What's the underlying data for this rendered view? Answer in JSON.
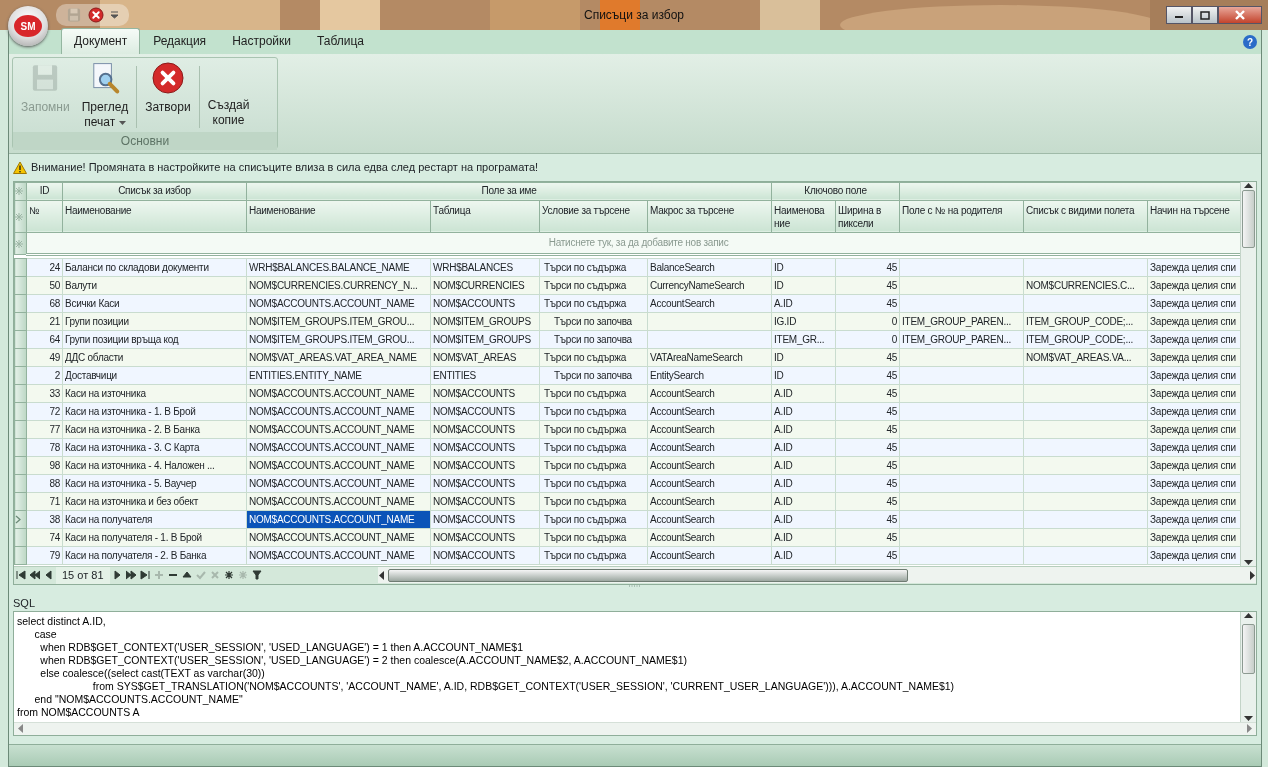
{
  "window": {
    "title": "Списъци за избор",
    "logo": "SM"
  },
  "quick_access": [
    {
      "kind": "save",
      "disabled": true
    },
    {
      "kind": "close",
      "disabled": false
    },
    {
      "kind": "dropdown",
      "disabled": false
    }
  ],
  "ribbon": {
    "tabs": [
      {
        "label": "Документ",
        "selected": true
      },
      {
        "label": "Редакция",
        "selected": false
      },
      {
        "label": "Настройки",
        "selected": false
      },
      {
        "label": "Таблица",
        "selected": false
      }
    ],
    "help": "?",
    "group": {
      "label": "Основни",
      "buttons": [
        {
          "kind": "save",
          "label": "Запомни",
          "disabled": true,
          "dropdown": false
        },
        {
          "kind": "preview",
          "label": "Преглед печат",
          "disabled": false,
          "dropdown": true
        },
        {
          "kind": "close",
          "label": "Затвори",
          "disabled": false,
          "dropdown": false
        },
        {
          "kind": "none",
          "label": "Създай копие",
          "disabled": false,
          "dropdown": false
        }
      ]
    }
  },
  "warning": "Внимание! Промяната в настройките на списъците влиза в сила едва след рестарт на програмата!",
  "grid": {
    "bands": [
      {
        "label": "ID"
      },
      {
        "label": "Списък за избор"
      },
      {
        "label": "Поле за име"
      },
      {
        "label": "Ключово поле"
      }
    ],
    "columns": [
      "№",
      "Наименование",
      "Наименование",
      "Таблица",
      "Условие за търсене",
      "Макрос за търсене",
      "Наименова ние",
      "Ширина в пиксели",
      "Поле с № на родителя",
      "Списък с видими полета",
      "Начин на търсене"
    ],
    "new_row": "Натиснете тук, за да добавите нов запис",
    "rows": [
      {
        "cells": [
          "24",
          "Баланси по складови документи",
          "WRH$BALANCES.BALANCE_NAME",
          "WRH$BALANCES",
          "Търси по съдържа",
          "BalanceSearch",
          "ID",
          "45",
          "",
          "",
          "Зарежда целия спи"
        ],
        "selected": false
      },
      {
        "cells": [
          "50",
          "Валути",
          "NOM$CURRENCIES.CURRENCY_N...",
          "NOM$CURRENCIES",
          "Търси по съдържа",
          "CurrencyNameSearch",
          "ID",
          "45",
          "",
          "NOM$CURRENCIES.C...",
          "Зарежда целия спи"
        ],
        "selected": false
      },
      {
        "cells": [
          "68",
          "Всички Каси",
          "NOM$ACCOUNTS.ACCOUNT_NAME",
          "NOM$ACCOUNTS",
          "Търси по съдържа",
          "AccountSearch",
          "A.ID",
          "45",
          "",
          "",
          "Зарежда целия спи"
        ],
        "selected": false
      },
      {
        "cells": [
          "21",
          "Групи позиции",
          "NOM$ITEM_GROUPS.ITEM_GROU...",
          "NOM$ITEM_GROUPS",
          "Търси по започва",
          "",
          "IG.ID",
          "0",
          "ITEM_GROUP_PAREN...",
          "ITEM_GROUP_CODE;...",
          "Зарежда целия спи"
        ],
        "selected": false
      },
      {
        "cells": [
          "64",
          "Групи позиции връща код",
          "NOM$ITEM_GROUPS.ITEM_GROU...",
          "NOM$ITEM_GROUPS",
          "Търси по започва",
          "",
          "ITEM_GR...",
          "0",
          "ITEM_GROUP_PAREN...",
          "ITEM_GROUP_CODE;...",
          "Зарежда целия спи"
        ],
        "selected": false
      },
      {
        "cells": [
          "49",
          "ДДС области",
          "NOM$VAT_AREAS.VAT_AREA_NAME",
          "NOM$VAT_AREAS",
          "Търси по съдържа",
          "VATAreaNameSearch",
          "ID",
          "45",
          "",
          "NOM$VAT_AREAS.VA...",
          "Зарежда целия спи"
        ],
        "selected": false
      },
      {
        "cells": [
          "2",
          "Доставчици",
          "ENTITIES.ENTITY_NAME",
          "ENTITIES",
          "Търси по започва",
          "EntitySearch",
          "ID",
          "45",
          "",
          "",
          "Зарежда целия спи"
        ],
        "selected": false
      },
      {
        "cells": [
          "33",
          "Каси на източника",
          "NOM$ACCOUNTS.ACCOUNT_NAME",
          "NOM$ACCOUNTS",
          "Търси по съдържа",
          "AccountSearch",
          "A.ID",
          "45",
          "",
          "",
          "Зарежда целия спи"
        ],
        "selected": false
      },
      {
        "cells": [
          "72",
          "Каси на източника - 1. В Брой",
          "NOM$ACCOUNTS.ACCOUNT_NAME",
          "NOM$ACCOUNTS",
          "Търси по съдържа",
          "AccountSearch",
          "A.ID",
          "45",
          "",
          "",
          "Зарежда целия спи"
        ],
        "selected": false
      },
      {
        "cells": [
          "77",
          "Каси на източника - 2. В Банка",
          "NOM$ACCOUNTS.ACCOUNT_NAME",
          "NOM$ACCOUNTS",
          "Търси по съдържа",
          "AccountSearch",
          "A.ID",
          "45",
          "",
          "",
          "Зарежда целия спи"
        ],
        "selected": false
      },
      {
        "cells": [
          "78",
          "Каси на източника - 3. С Карта",
          "NOM$ACCOUNTS.ACCOUNT_NAME",
          "NOM$ACCOUNTS",
          "Търси по съдържа",
          "AccountSearch",
          "A.ID",
          "45",
          "",
          "",
          "Зарежда целия спи"
        ],
        "selected": false
      },
      {
        "cells": [
          "98",
          "Каси на източника - 4. Наложен ...",
          "NOM$ACCOUNTS.ACCOUNT_NAME",
          "NOM$ACCOUNTS",
          "Търси по съдържа",
          "AccountSearch",
          "A.ID",
          "45",
          "",
          "",
          "Зарежда целия спи"
        ],
        "selected": false
      },
      {
        "cells": [
          "88",
          "Каси на източника - 5. Ваучер",
          "NOM$ACCOUNTS.ACCOUNT_NAME",
          "NOM$ACCOUNTS",
          "Търси по съдържа",
          "AccountSearch",
          "A.ID",
          "45",
          "",
          "",
          "Зарежда целия спи"
        ],
        "selected": false
      },
      {
        "cells": [
          "71",
          "Каси на източника и без обект",
          "NOM$ACCOUNTS.ACCOUNT_NAME",
          "NOM$ACCOUNTS",
          "Търси по съдържа",
          "AccountSearch",
          "A.ID",
          "45",
          "",
          "",
          "Зарежда целия спи"
        ],
        "selected": false
      },
      {
        "cells": [
          "38",
          "Каси на получателя",
          "NOM$ACCOUNTS.ACCOUNT_NAME",
          "NOM$ACCOUNTS",
          "Търси по съдържа",
          "AccountSearch",
          "A.ID",
          "45",
          "",
          "",
          "Зарежда целия спи"
        ],
        "selected": true
      },
      {
        "cells": [
          "74",
          "Каси на получателя - 1. В Брой",
          "NOM$ACCOUNTS.ACCOUNT_NAME",
          "NOM$ACCOUNTS",
          "Търси по съдържа",
          "AccountSearch",
          "A.ID",
          "45",
          "",
          "",
          "Зарежда целия спи"
        ],
        "selected": false
      },
      {
        "cells": [
          "79",
          "Каси на получателя - 2. В Банка",
          "NOM$ACCOUNTS.ACCOUNT_NAME",
          "NOM$ACCOUNTS",
          "Търси по съдържа",
          "AccountSearch",
          "A.ID",
          "45",
          "",
          "",
          "Зарежда целия спи"
        ],
        "selected": false
      }
    ],
    "navigator": {
      "position": "15 от 81",
      "buttons": [
        {
          "kind": "first",
          "disabled": false
        },
        {
          "kind": "prev_page",
          "disabled": false
        },
        {
          "kind": "prev",
          "disabled": false
        },
        {
          "kind": "next",
          "disabled": false
        },
        {
          "kind": "next_page",
          "disabled": false
        },
        {
          "kind": "last",
          "disabled": false
        },
        {
          "kind": "add",
          "disabled": true
        },
        {
          "kind": "remove",
          "disabled": false
        },
        {
          "kind": "up",
          "disabled": false
        },
        {
          "kind": "confirm",
          "disabled": true
        },
        {
          "kind": "cancel",
          "disabled": true
        },
        {
          "kind": "star",
          "disabled": false
        },
        {
          "kind": "star",
          "disabled": true
        },
        {
          "kind": "filter",
          "disabled": false
        }
      ]
    }
  },
  "sql": {
    "label": "SQL",
    "lines": [
      "select distinct A.ID,",
      "      case",
      "        when RDB$GET_CONTEXT('USER_SESSION', 'USED_LANGUAGE') = 1 then A.ACCOUNT_NAME$1",
      "        when RDB$GET_CONTEXT('USER_SESSION', 'USED_LANGUAGE') = 2 then coalesce(A.ACCOUNT_NAME$2, A.ACCOUNT_NAME$1)",
      "        else coalesce((select cast(TEXT as varchar(30))",
      "                          from SYS$GET_TRANSLATION('NOM$ACCOUNTS', 'ACCOUNT_NAME', A.ID, RDB$GET_CONTEXT('USER_SESSION', 'CURRENT_USER_LANGUAGE'))), A.ACCOUNT_NAME$1)",
      "      end \"NOM$ACCOUNTS.ACCOUNT_NAME\"",
      "from NOM$ACCOUNTS A"
    ]
  }
}
